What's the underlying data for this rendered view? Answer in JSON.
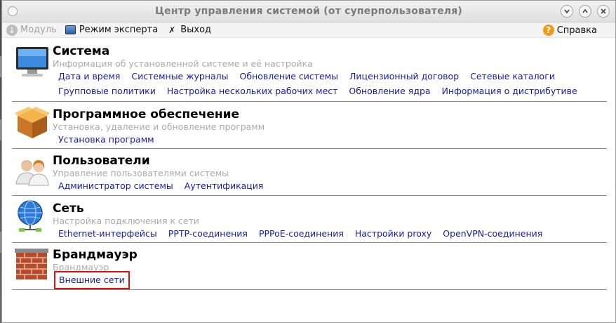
{
  "window": {
    "title": "Центр управления системой (от суперпользователя)"
  },
  "toolbar": {
    "module_label": "Модуль",
    "expert_label": "Режим эксперта",
    "exit_label": "Выход",
    "help_label": "Справка"
  },
  "sections": [
    {
      "title": "Система",
      "description": "Информация об установленной системе и её настройка",
      "icon": "monitor-icon",
      "links": [
        "Дата и время",
        "Системные журналы",
        "Обновление системы",
        "Лицензионный договор",
        "Сетевые каталоги",
        "Групповые политики",
        "Настройка нескольких рабочих мест",
        "Обновление ядра",
        "Информация о дистрибутиве"
      ]
    },
    {
      "title": "Программное обеспечение",
      "description": "Установка, удаление и обновление программ",
      "icon": "package-icon",
      "links": [
        "Установка программ"
      ]
    },
    {
      "title": "Пользователи",
      "description": "Управление пользователями системы",
      "icon": "users-icon",
      "links": [
        "Администратор системы",
        "Аутентификация"
      ]
    },
    {
      "title": "Сеть",
      "description": "Настройка подключения к сети",
      "icon": "network-globe-icon",
      "links": [
        "Ethernet-интерфейсы",
        "PPTP-соединения",
        "PPPoE-соединения",
        "Настройки proxy",
        "OpenVPN-соединения"
      ]
    },
    {
      "title": "Брандмауэр",
      "description": "Брандмауэр",
      "icon": "firewall-brick-icon",
      "links": [
        "Внешние сети"
      ]
    }
  ],
  "colors": {
    "link": "#1a1aa6",
    "highlight": "#e01010",
    "description": "#ababab"
  }
}
